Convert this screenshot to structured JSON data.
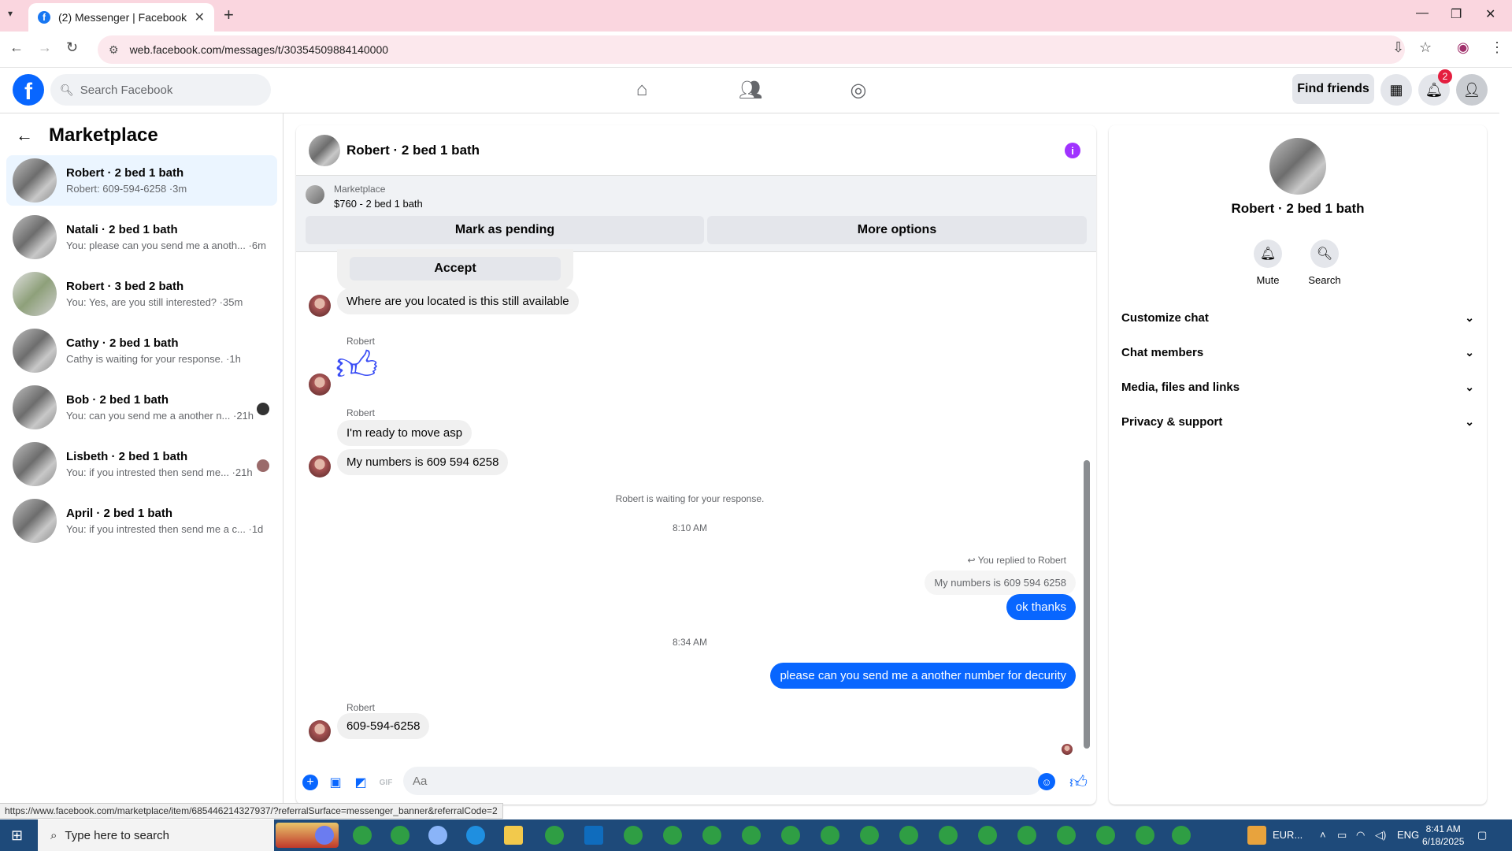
{
  "browser": {
    "tab_title": "(2) Messenger | Facebook",
    "url": "web.facebook.com/messages/t/30354509884140000"
  },
  "header": {
    "search_placeholder": "Search Facebook",
    "find_friends": "Find friends",
    "notif_count": "2"
  },
  "sidebar": {
    "title": "Marketplace",
    "conversations": [
      {
        "name": "Robert · 2 bed 1 bath",
        "preview": "Robert: 609-594-6258 ·3m"
      },
      {
        "name": "Natali · 2 bed 1 bath",
        "preview": "You: please can you send me a anoth... ·6m"
      },
      {
        "name": "Robert · 3 bed 2 bath",
        "preview": "You: Yes, are you still interested? ·35m"
      },
      {
        "name": "Cathy · 2 bed 1 bath",
        "preview": "Cathy is waiting for your response. ·1h"
      },
      {
        "name": "Bob · 2 bed 1 bath",
        "preview": "You: can you send me a another n... ·21h"
      },
      {
        "name": "Lisbeth · 2 bed 1 bath",
        "preview": "You: if you intrested then send me... ·21h"
      },
      {
        "name": "April · 2 bed 1 bath",
        "preview": "You: if you intrested then send me a c... ·1d"
      }
    ]
  },
  "chat": {
    "title": "Robert · 2 bed 1 bath",
    "marketplace_label": "Marketplace",
    "listing": "$760 - 2 bed 1 bath",
    "mark_pending": "Mark as pending",
    "more_options": "More options",
    "accept": "Accept",
    "sender": "Robert",
    "messages": {
      "m1": "Where are you located is this still available",
      "m2": "I'm ready to move  asp",
      "m3": "My numbers is 609 594 6258",
      "waiting": "Robert is waiting for your response.",
      "time1": "8:10 AM",
      "replied_to": "You replied to Robert",
      "quoted": "My numbers is 609 594 6258",
      "m4": "ok thanks",
      "time2": "8:34 AM",
      "m5": "please can you send me a another number for decurity",
      "m6": "609-594-6258"
    },
    "composer_placeholder": "Aa"
  },
  "info_panel": {
    "name": "Robert · 2 bed 1 bath",
    "mute": "Mute",
    "search": "Search",
    "rows": [
      "Customize chat",
      "Chat members",
      "Media, files and links",
      "Privacy & support"
    ]
  },
  "status_url": "https://www.facebook.com/marketplace/item/685446214327937/?referralSurface=messenger_banner&referralCode=2",
  "taskbar": {
    "search_placeholder": "Type here to search",
    "currency": "EUR...",
    "lang": "ENG",
    "time": "8:41 AM",
    "date": "6/18/2025"
  }
}
